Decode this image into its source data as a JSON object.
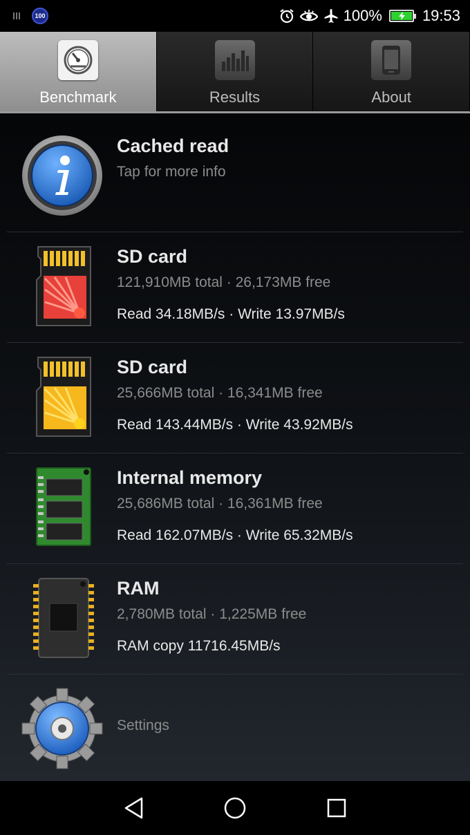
{
  "status_bar": {
    "badge": "100",
    "battery_percent": "100%",
    "time": "19:53",
    "icons": [
      "signal-icon",
      "alarm-icon",
      "eye-icon",
      "airplane-icon",
      "battery-charging-icon"
    ]
  },
  "tabs": [
    {
      "label": "Benchmark",
      "icon": "speedometer-icon",
      "active": true
    },
    {
      "label": "Results",
      "icon": "bar-chart-icon",
      "active": false
    },
    {
      "label": "About",
      "icon": "phone-icon",
      "active": false
    }
  ],
  "items": [
    {
      "title": "Cached read",
      "subtitle": "Tap for more info",
      "icon": "info-icon"
    },
    {
      "title": "SD card",
      "subtitle": "121,910MB total · 26,173MB free",
      "speed": "Read 34.18MB/s · Write 13.97MB/s",
      "icon": "sd-card-red-icon"
    },
    {
      "title": "SD card",
      "subtitle": "25,666MB total · 16,341MB free",
      "speed": "Read 143.44MB/s · Write 43.92MB/s",
      "icon": "sd-card-yellow-icon"
    },
    {
      "title": "Internal memory",
      "subtitle": "25,686MB total · 16,361MB free",
      "speed": "Read 162.07MB/s · Write 65.32MB/s",
      "icon": "memory-chip-icon"
    },
    {
      "title": "RAM",
      "subtitle": "2,780MB total · 1,225MB free",
      "speed": "RAM copy 11716.45MB/s",
      "icon": "ram-chip-icon"
    },
    {
      "title": "Settings",
      "icon": "settings-gear-icon"
    }
  ],
  "nav": [
    "back-icon",
    "home-icon",
    "recents-icon"
  ]
}
